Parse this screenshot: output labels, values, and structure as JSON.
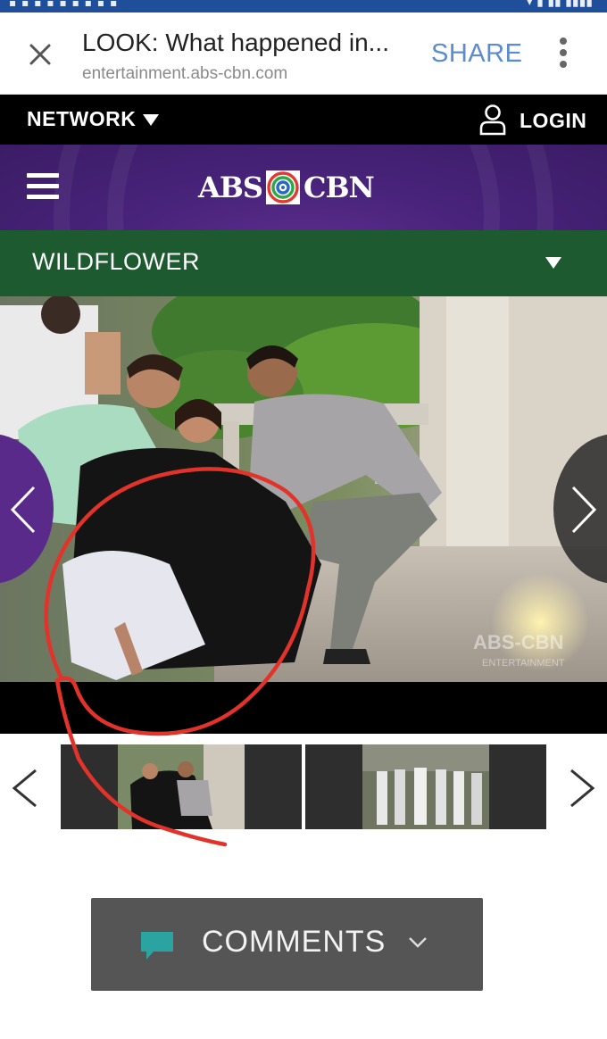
{
  "browser": {
    "title": "LOOK: What happened in...",
    "url": "entertainment.abs-cbn.com",
    "share_label": "SHARE"
  },
  "network_bar": {
    "network_label": "NETWORK",
    "login_label": "LOGIN"
  },
  "brand": {
    "left": "ABS",
    "right": "CBN"
  },
  "section": {
    "title": "WILDFLOWER"
  },
  "photo": {
    "watermark_top": "ABS-CBN",
    "watermark_bottom": "ENTERTAINMENT"
  },
  "comments": {
    "label": "COMMENTS"
  },
  "colors": {
    "network_bar": "#000000",
    "brand_bar": "#48237a",
    "section_bar": "#1d5a30",
    "share": "#5b8bd0",
    "comments_bg": "#555555",
    "comment_icon": "#2ba3a0",
    "annotation": "#e2332a"
  },
  "icons": {
    "close": "close-icon",
    "menu": "kebab-menu-icon",
    "user": "user-icon",
    "hamburger": "hamburger-menu-icon",
    "comment": "speech-bubble-icon"
  }
}
